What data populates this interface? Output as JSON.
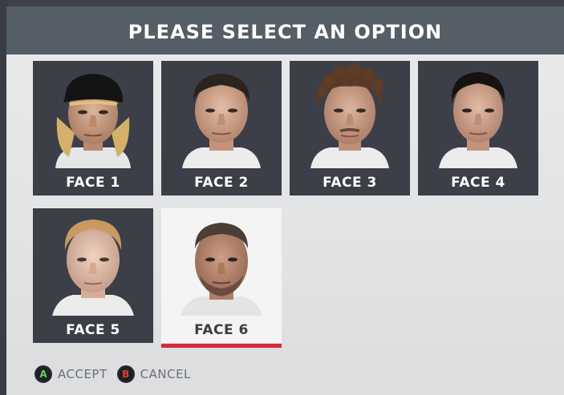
{
  "dialog": {
    "title": "PLEASE SELECT AN OPTION"
  },
  "faces": [
    {
      "label": "FACE 1",
      "selected": false
    },
    {
      "label": "FACE 2",
      "selected": false
    },
    {
      "label": "FACE 3",
      "selected": false
    },
    {
      "label": "FACE 4",
      "selected": false
    },
    {
      "label": "FACE 5",
      "selected": false
    },
    {
      "label": "FACE 6",
      "selected": true
    }
  ],
  "footer": {
    "accept_key": "A",
    "accept_label": "ACCEPT",
    "cancel_key": "B",
    "cancel_label": "CANCEL"
  },
  "colors": {
    "header_bg": "#555d66",
    "tile_bg": "#3c3f47",
    "selected_bg": "#f4f4f4",
    "selected_accent": "#d8283b",
    "accept_key_color": "#5fd35a",
    "cancel_key_color": "#e33b3b"
  }
}
